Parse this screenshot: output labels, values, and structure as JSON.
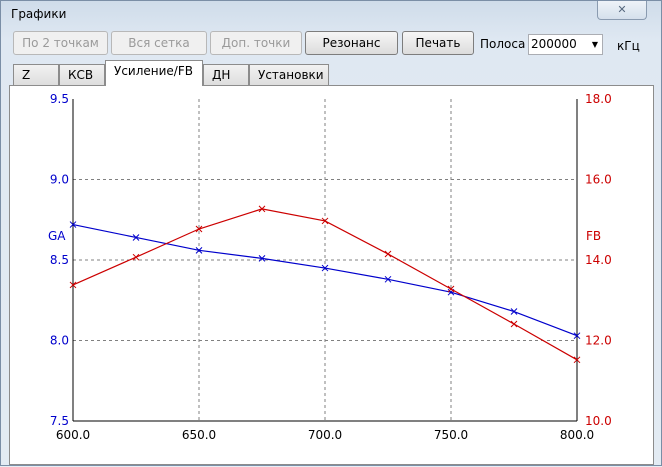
{
  "window": {
    "title": "Графики",
    "close": "✕"
  },
  "toolbar": {
    "by2": "По 2 точкам",
    "grid": "Вся сетка",
    "extra": "Доп. точки",
    "resonance": "Резонанс",
    "print": "Печать",
    "band_label": "Полоса",
    "band_value": "200000",
    "unit": "кГц"
  },
  "tabs": [
    "Z",
    "КСВ",
    "Усиление/FB",
    "ДН",
    "Установки"
  ],
  "chart_data": {
    "type": "line",
    "x": [
      600,
      625,
      650,
      675,
      700,
      725,
      750,
      775,
      800
    ],
    "xlim": [
      600,
      800
    ],
    "xticks": [
      "600.0",
      "650.0",
      "700.0",
      "750.0",
      "800.0"
    ],
    "series": [
      {
        "name": "GA",
        "axis": "left",
        "color": "#0000cc",
        "values": [
          8.72,
          8.64,
          8.56,
          8.51,
          8.45,
          8.38,
          8.3,
          8.18,
          8.03
        ]
      },
      {
        "name": "FB",
        "axis": "right",
        "color": "#cc0000",
        "values": [
          13.38,
          14.07,
          14.77,
          15.27,
          14.97,
          14.15,
          13.28,
          12.41,
          11.52
        ]
      }
    ],
    "ylim_left": [
      7.5,
      9.5
    ],
    "yticks_left": [
      "7.5",
      "8.0",
      "8.5",
      "9.0",
      "9.5"
    ],
    "ylim_right": [
      10,
      18
    ],
    "yticks_right": [
      "10.0",
      "12.0",
      "14.0",
      "16.0",
      "18.0"
    ],
    "ylabel_left": "GA",
    "ylabel_right": "FB",
    "grid": true
  }
}
